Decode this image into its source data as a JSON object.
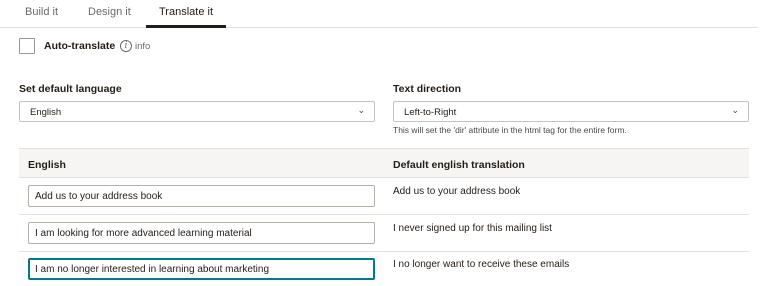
{
  "tabs": [
    {
      "label": "Build it",
      "active": false
    },
    {
      "label": "Design it",
      "active": false
    },
    {
      "label": "Translate it",
      "active": true
    }
  ],
  "auto_translate": {
    "label": "Auto-translate",
    "checked": false,
    "info_icon": "info-icon",
    "info_label": "info"
  },
  "language": {
    "label": "Set default language",
    "value": "English"
  },
  "direction": {
    "label": "Text direction",
    "value": "Left-to-Right",
    "hint": "This will set the 'dir' attribute in the html tag for the entire form."
  },
  "table": {
    "col_left": "English",
    "col_right": "Default english translation",
    "rows": [
      {
        "value": "Add us to your address book",
        "default": "Add us to your address book"
      },
      {
        "value": "I am looking for more advanced learning material",
        "default": "I never signed up for this mailing list"
      },
      {
        "value": "I am no longer interested in learning about marketing",
        "default": "I no longer want to receive these emails"
      }
    ]
  },
  "colors": {
    "text": "#241c15",
    "focus": "#007c89",
    "header_bg": "#f6f5f3"
  }
}
